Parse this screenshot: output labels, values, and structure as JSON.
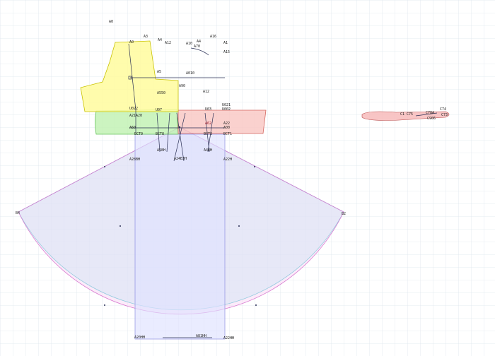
{
  "colors": {
    "grid": "#dde6ee",
    "yellow": "#fffb9e",
    "yellow_stroke": "#c9c200",
    "green": "#bff1b0",
    "green_stroke": "#66c25a",
    "salmon": "#f9c6c2",
    "salmon_stroke": "#d4665f",
    "cyan": "#b9f4f6",
    "cyan_stroke": "#3fc6cc",
    "pink": "#f8d3f4",
    "pink_stroke": "#d87ad0",
    "lavender": "#dfe2ff",
    "line_dark": "#2a2f55",
    "label_dark": "#222222",
    "label_red": "#9b1c2c"
  },
  "labels": {
    "top": [
      {
        "id": "lbl-a0",
        "text": "A0"
      },
      {
        "id": "lbl-a3",
        "text": "A3"
      },
      {
        "id": "lbl-a4",
        "text": "A4"
      },
      {
        "id": "lbl-a12",
        "text": "A12"
      },
      {
        "id": "lbl-a10",
        "text": "A10"
      },
      {
        "id": "lbl-a4b",
        "text": "A4"
      },
      {
        "id": "lbl-a16",
        "text": "A16"
      },
      {
        "id": "lbl-a1",
        "text": "A1"
      },
      {
        "id": "lbl-a15",
        "text": "A15"
      },
      {
        "id": "lbl-a0t",
        "text": "A0"
      },
      {
        "id": "lbl-a5",
        "text": "A5"
      },
      {
        "id": "lbl-a010",
        "text": "A010"
      },
      {
        "id": "lbl-a550",
        "text": "A550"
      },
      {
        "id": "lbl-a12b",
        "text": "A12"
      },
      {
        "id": "lbl-a90",
        "text": "A90"
      },
      {
        "id": "lbl-a70",
        "text": "A70"
      }
    ],
    "middle": [
      {
        "id": "lbl-u022",
        "text": "U022"
      },
      {
        "id": "lbl-u07",
        "text": "U07"
      },
      {
        "id": "lbl-u03",
        "text": "U03"
      },
      {
        "id": "lbl-u021",
        "text": "U021"
      },
      {
        "id": "lbl-u002",
        "text": "U002"
      },
      {
        "id": "lbl-a21a20",
        "text": "A21A20"
      },
      {
        "id": "lbl-a62",
        "text": "A62"
      },
      {
        "id": "lbl-a22",
        "text": "A22"
      },
      {
        "id": "lbl-a00",
        "text": "A00"
      },
      {
        "id": "lbl-a60",
        "text": "A60"
      },
      {
        "id": "lbl-bct0",
        "text": "BCT0"
      },
      {
        "id": "lbl-bct8",
        "text": "BCT8"
      },
      {
        "id": "lbl-bct3",
        "text": "BCT3"
      },
      {
        "id": "lbl-bct1",
        "text": "BCT1"
      },
      {
        "id": "lbl-a28bh",
        "text": "A28BH"
      },
      {
        "id": "lbl-a98h",
        "text": "A98H"
      },
      {
        "id": "lbl-a248h",
        "text": "A24B3H"
      },
      {
        "id": "lbl-a48h",
        "text": "A48H"
      },
      {
        "id": "lbl-a22h",
        "text": "A22H"
      }
    ],
    "sides": [
      {
        "id": "lbl-b4",
        "text": "B4"
      },
      {
        "id": "lbl-b2",
        "text": "B2"
      },
      {
        "id": "lbl-a20hh",
        "text": "A20HH"
      },
      {
        "id": "lbl-a81hh",
        "text": "A81HH"
      },
      {
        "id": "lbl-a22hh",
        "text": "A22HH"
      }
    ],
    "right": [
      {
        "id": "lbl-c74",
        "text": "C74"
      },
      {
        "id": "lbl-c1c75",
        "text": "C1 C75"
      },
      {
        "id": "lbl-c78a",
        "text": "C78A"
      },
      {
        "id": "lbl-c73",
        "text": "C73"
      },
      {
        "id": "lbl-c906",
        "text": "C906"
      }
    ]
  }
}
